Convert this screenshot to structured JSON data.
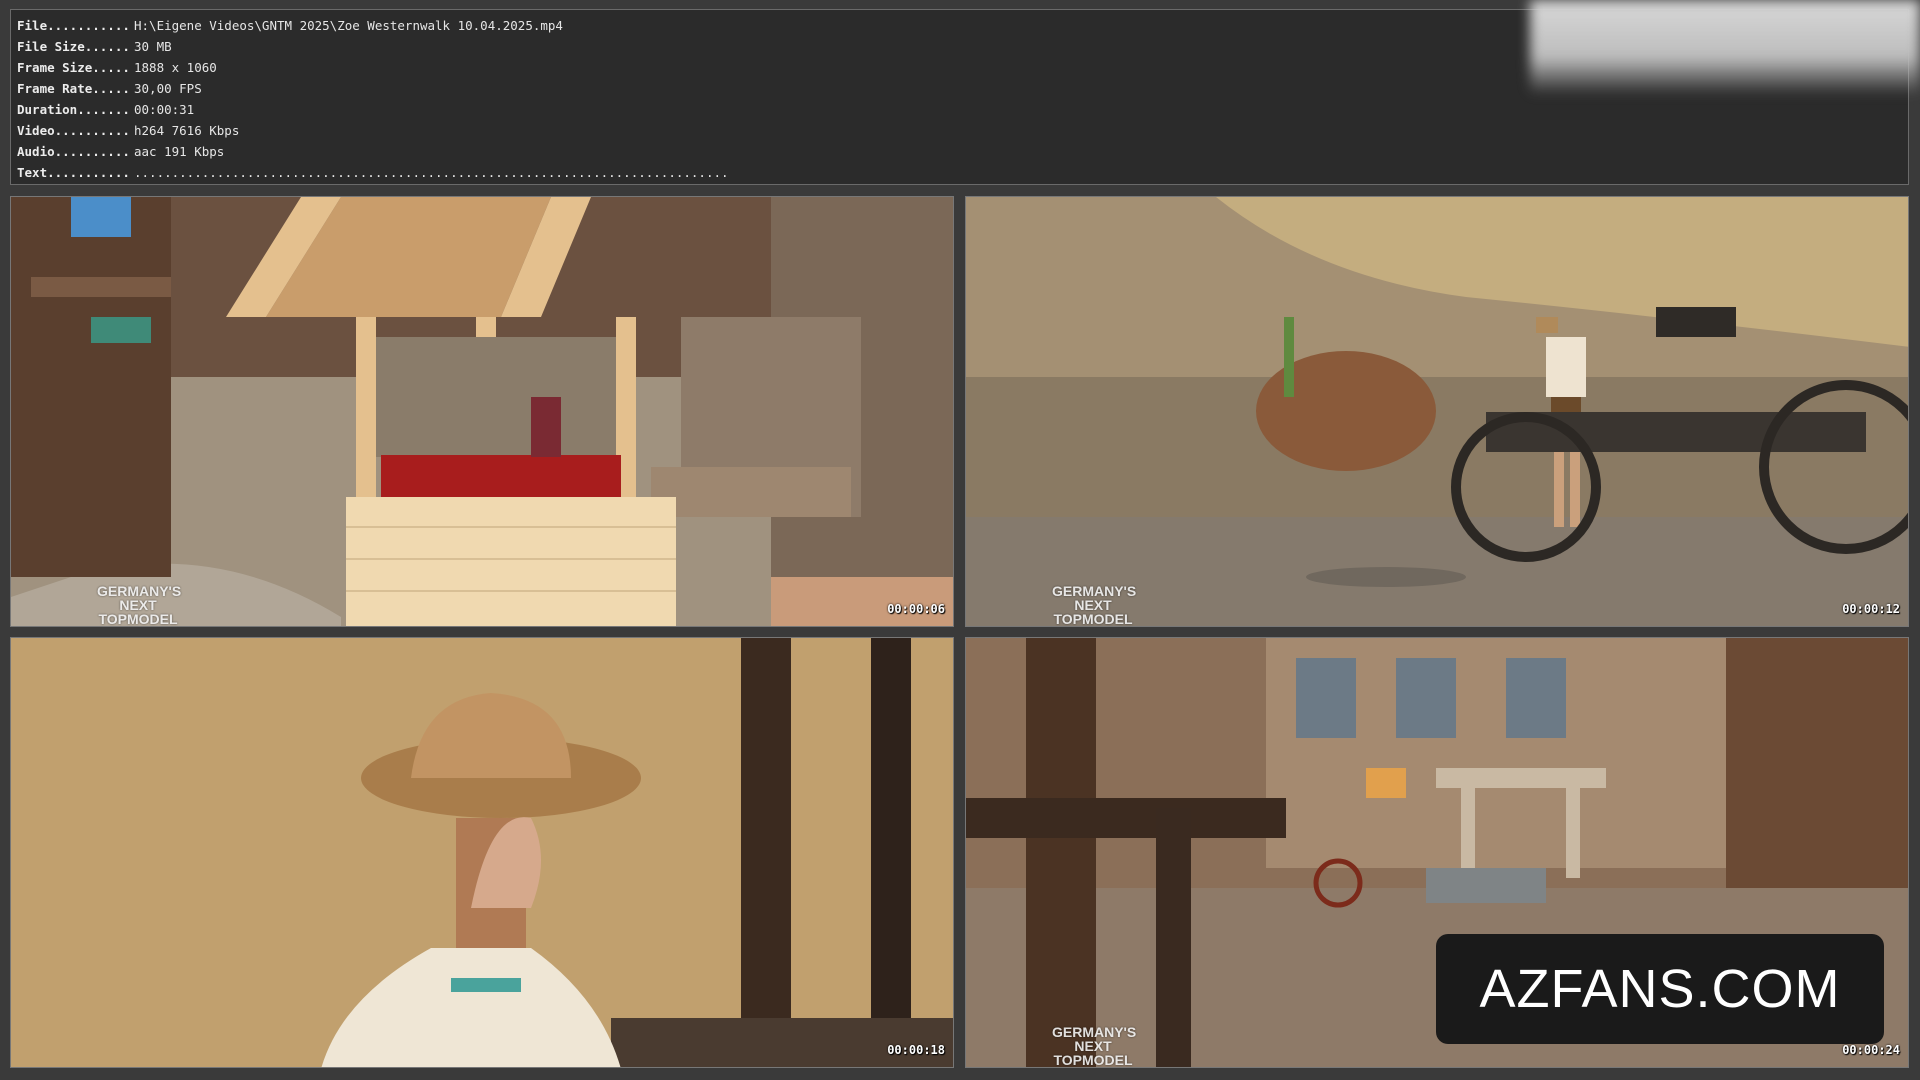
{
  "info": [
    {
      "key": "File...........",
      "value": "H:\\Eigene Videos\\GNTM 2025\\Zoe Westernwalk 10.04.2025.mp4"
    },
    {
      "key": "File Size......",
      "value": "30 MB"
    },
    {
      "key": "Frame Size.....",
      "value": "1888 x 1060"
    },
    {
      "key": "Frame Rate.....",
      "value": "30,00 FPS"
    },
    {
      "key": "Duration.......",
      "value": "00:00:31"
    },
    {
      "key": "Video..........",
      "value": "h264 7616 Kbps"
    },
    {
      "key": "Audio..........",
      "value": "aac 191 Kbps"
    },
    {
      "key": "Text...........",
      "value": "..............................................................................."
    }
  ],
  "thumbnails": [
    {
      "timestamp": "00:00:06",
      "logo": [
        "GERMANY'S",
        "NEXT",
        "TOPMODEL"
      ]
    },
    {
      "timestamp": "00:00:12",
      "logo": [
        "GERMANY'S",
        "NEXT",
        "TOPMODEL"
      ]
    },
    {
      "timestamp": "00:00:18",
      "logo": []
    },
    {
      "timestamp": "00:00:24",
      "logo": [
        "GERMANY'S",
        "NEXT",
        "TOPMODEL"
      ]
    }
  ],
  "watermark": "AZFANS.COM"
}
